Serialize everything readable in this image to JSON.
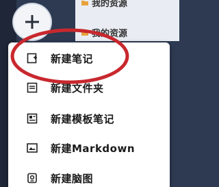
{
  "app": {
    "accent_color": "#c8282e",
    "sidebar_color": "#1e2637"
  },
  "new_button": {
    "icon": "plus-icon"
  },
  "background_list": {
    "items": [
      {
        "icon": "folder-icon",
        "label": "我的资源"
      },
      {
        "icon": "folder-icon",
        "label": "我的资源"
      }
    ]
  },
  "menu": {
    "items": [
      {
        "icon": "new-note-icon",
        "label": "新建笔记"
      },
      {
        "icon": "new-folder-icon",
        "label": "新建文件夹"
      },
      {
        "icon": "template-note-icon",
        "label": "新建模板笔记"
      },
      {
        "icon": "markdown-icon",
        "label": "新建Markdown"
      },
      {
        "icon": "mindmap-icon",
        "label": "新建脑图"
      }
    ]
  },
  "annotation": {
    "type": "ellipse",
    "color": "#c8282e",
    "target": "新建笔记"
  }
}
